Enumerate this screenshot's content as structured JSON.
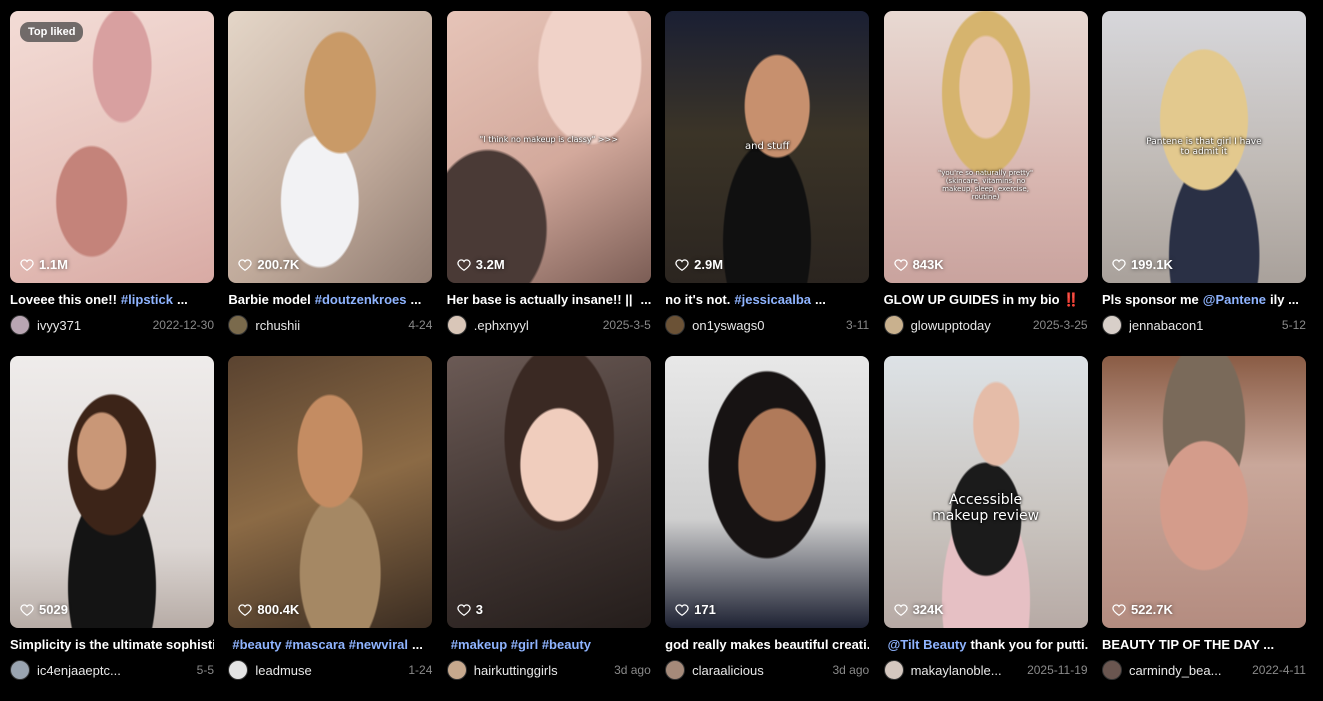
{
  "badge": "Top liked",
  "row1": [
    {
      "likes": "1.1M",
      "caption": "Loveee this one!!",
      "tags": "#lipstick",
      "suffix": "...",
      "user": "ivyy371",
      "date": "2022-12-30",
      "overlay": ""
    },
    {
      "likes": "200.7K",
      "caption": "Barbie model",
      "tags": "#doutzenkroes",
      "suffix": "...",
      "user": "rchushii",
      "date": "4-24",
      "overlay": ""
    },
    {
      "likes": "3.2M",
      "caption": "Her base is actually insane!! ||",
      "tags": "",
      "suffix": "...",
      "user": ".ephxnyyl",
      "date": "2025-3-5",
      "overlay": "\"I think no makeup is classy\" >>>"
    },
    {
      "likes": "2.9M",
      "caption": "no it's not.",
      "tags": "#jessicaalba",
      "suffix": "...",
      "user": "on1yswags0",
      "date": "3-11",
      "overlay": "and stuff"
    },
    {
      "likes": "843K",
      "caption": "GLOW UP GUIDES in my bio ‼️",
      "tags": "",
      "suffix": "...",
      "user": "glowupptoday",
      "date": "2025-3-25",
      "overlay": "\"you're so naturally pretty\" (skincare, vitamins, no makeup, sleep, exercise, routine)"
    },
    {
      "likes": "199.1K",
      "caption": "Pls sponsor me",
      "tags": "@Pantene",
      "suffix": "ily ...",
      "user": "jennabacon1",
      "date": "5-12",
      "overlay": "Pantene is that girl I have to admit it"
    }
  ],
  "row2": [
    {
      "likes": "5029",
      "caption": "Simplicity is the ultimate sophisti...",
      "tags": "",
      "suffix": "",
      "user": "ic4enjaaeptc...",
      "date": "5-5",
      "overlay": ""
    },
    {
      "likes": "800.4K",
      "caption": "",
      "tags": "#beauty #mascara #newviral",
      "suffix": "...",
      "user": "leadmuse",
      "date": "1-24",
      "overlay": ""
    },
    {
      "likes": "3",
      "caption": "",
      "tags": "#makeup #girl #beauty",
      "suffix": "",
      "user": "hairkuttinggirls",
      "date": "3d ago",
      "overlay": ""
    },
    {
      "likes": "171",
      "caption": "god really makes beautiful creati...",
      "tags": "",
      "suffix": "",
      "user": "claraalicious",
      "date": "3d ago",
      "overlay": ""
    },
    {
      "likes": "324K",
      "caption": "",
      "tags": "@Tilt Beauty",
      "suffix": "thank you for putti...",
      "user": "makaylanoble...",
      "date": "2025-11-19",
      "overlay": "Accessible makeup review"
    },
    {
      "likes": "522.7K",
      "caption": "BEAUTY TIP OF THE DAY ...",
      "tags": "",
      "suffix": "",
      "user": "carmindy_bea...",
      "date": "2022-4-11",
      "overlay": ""
    }
  ]
}
